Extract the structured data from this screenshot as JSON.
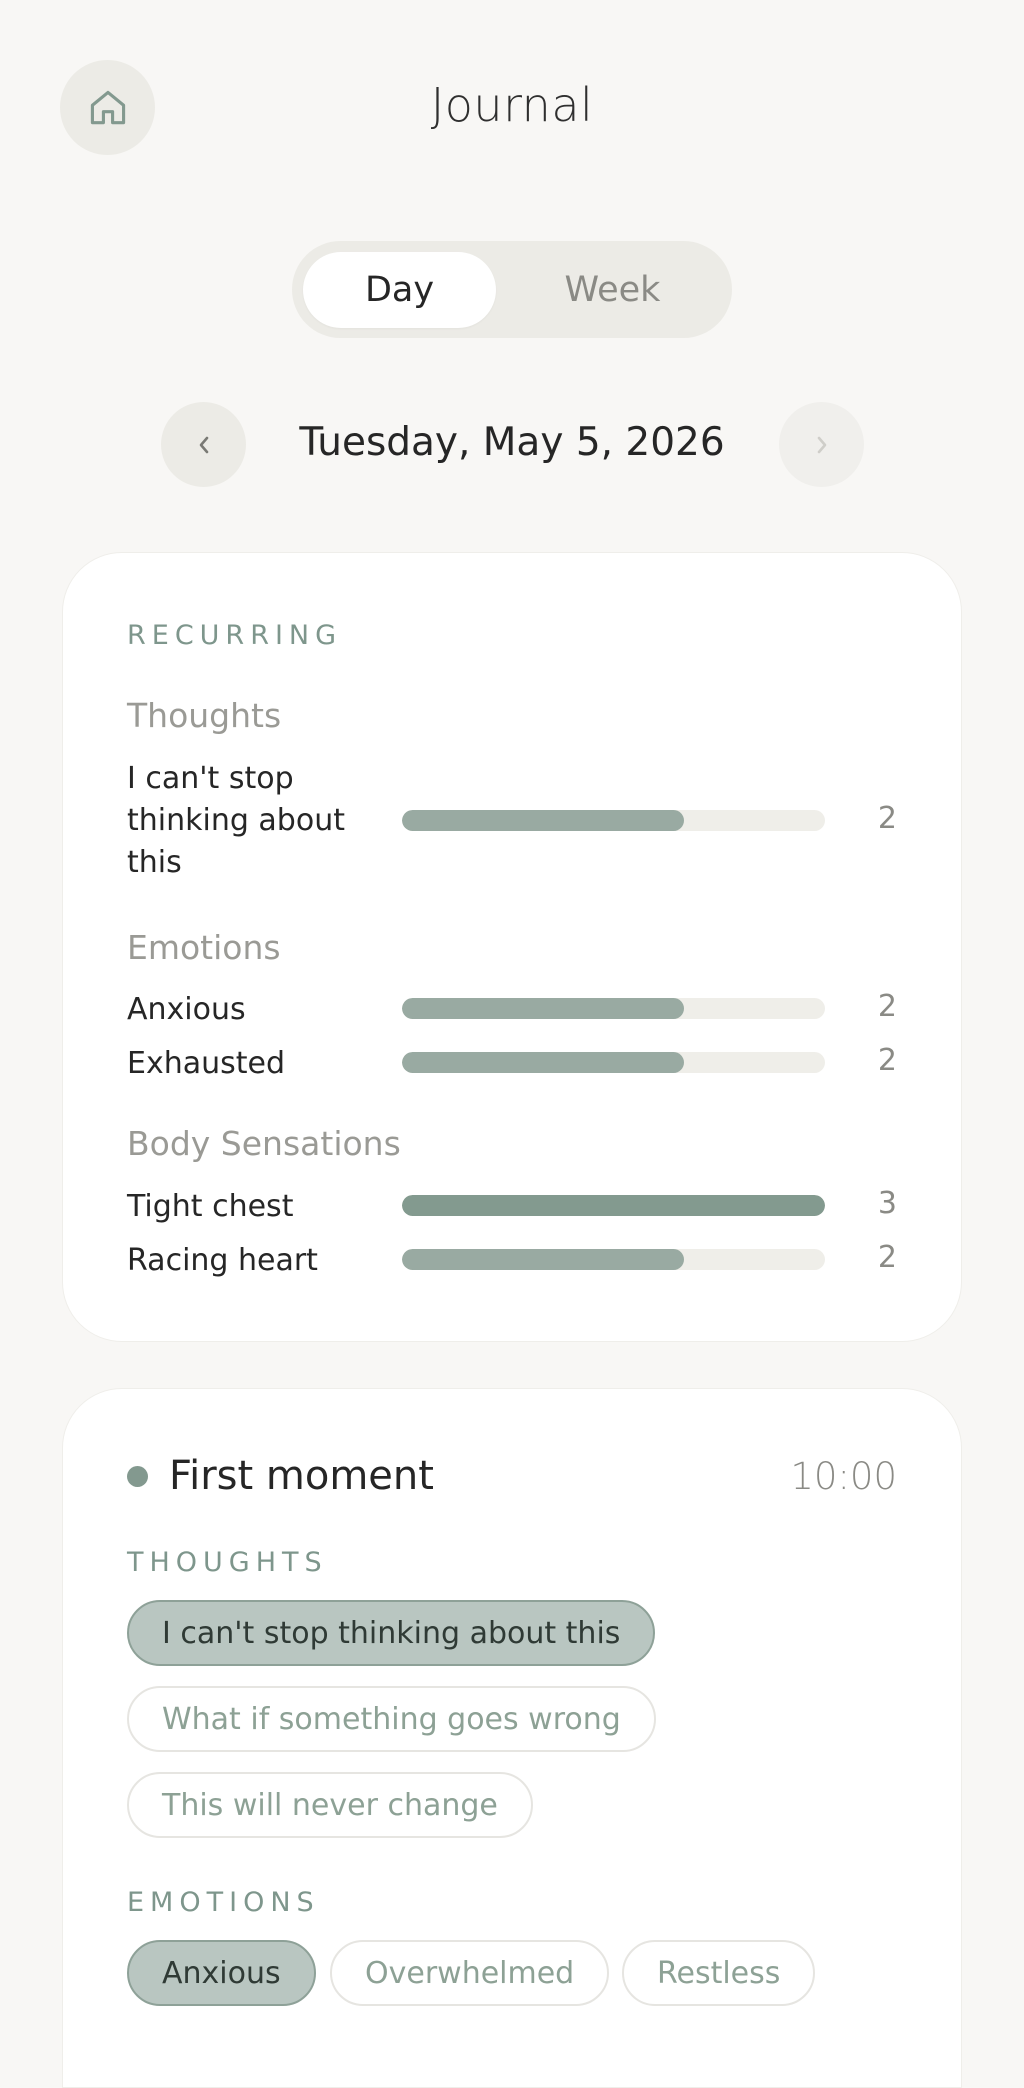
{
  "header": {
    "title": "Journal"
  },
  "view_toggle": {
    "options": [
      "Day",
      "Week"
    ],
    "selected": "Day"
  },
  "date_nav": {
    "date": "Tuesday, May 5, 2026",
    "prev_glyph": "‹",
    "next_glyph": "›"
  },
  "recurring": {
    "heading": "RECURRING",
    "groups": [
      {
        "title": "Thoughts",
        "items": [
          {
            "label": "I can't stop thinking about this",
            "count": 2,
            "fraction": 0.6667
          }
        ]
      },
      {
        "title": "Emotions",
        "items": [
          {
            "label": "Anxious",
            "count": 2,
            "fraction": 0.6667
          },
          {
            "label": "Exhausted",
            "count": 2,
            "fraction": 0.6667
          }
        ]
      },
      {
        "title": "Body Sensations",
        "items": [
          {
            "label": "Tight chest",
            "count": 3,
            "fraction": 1.0
          },
          {
            "label": "Racing heart",
            "count": 2,
            "fraction": 0.6667
          }
        ]
      }
    ]
  },
  "moment": {
    "title": "First moment",
    "time": "10:00",
    "thoughts_heading": "THOUGHTS",
    "thoughts": [
      {
        "label": "I can't stop thinking about this",
        "selected": true
      },
      {
        "label": "What if something goes wrong",
        "selected": false
      },
      {
        "label": "This will never change",
        "selected": false
      }
    ],
    "emotions_heading": "EMOTIONS",
    "emotions": [
      {
        "label": "Anxious",
        "selected": true
      },
      {
        "label": "Overwhelmed",
        "selected": false
      },
      {
        "label": "Restless",
        "selected": false
      }
    ]
  },
  "colors": {
    "accent": "#83998f",
    "bar_fill": "#99aaa2",
    "bar_track": "#efeee9",
    "chip_selected_bg": "#b9c6c1",
    "background": "#f8f7f5"
  },
  "icons": {
    "home": "home-icon",
    "prev": "chevron-left-icon",
    "next": "chevron-right-icon"
  }
}
